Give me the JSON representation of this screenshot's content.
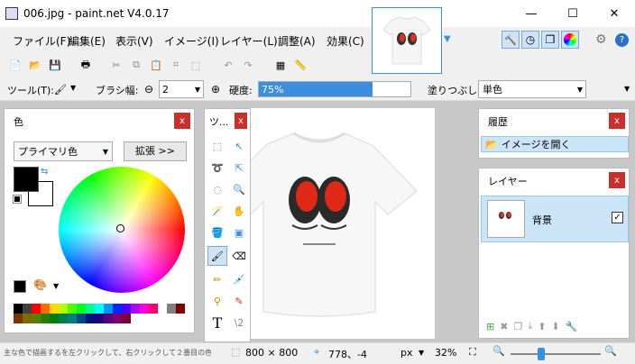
{
  "titlebar": {
    "title": "006.jpg - paint.net V4.0.17",
    "min": "—",
    "max": "☐",
    "close": "✕"
  },
  "menu": [
    "ファイル(F)",
    "編集(E)",
    "表示(V)",
    "イメージ(I)",
    "レイヤー(L)",
    "調整(A)",
    "効果(C)"
  ],
  "toolbar2": {
    "tool_label": "ツール(T):",
    "brush_label": "ブラシ幅:",
    "brush_value": "2",
    "hardness_label": "硬度:",
    "hardness_value": "75%",
    "hardness_percent": 75,
    "fill_label": "塗りつぶし:",
    "fill_value": "単色"
  },
  "colors": {
    "title": "色",
    "mode": "プライマリ色",
    "expand": "拡張 >>",
    "primary": "#000000",
    "secondary": "#ffffff"
  },
  "tools": {
    "title": "ツ..."
  },
  "history": {
    "title": "履歴",
    "item": "イメージを開く"
  },
  "layers": {
    "title": "レイヤー",
    "item": "背景"
  },
  "status": {
    "hint": "主な色で描画するを左クリックして、右クリックして２番目の色と描画",
    "size": "800 × 800",
    "cursor": "778、-4",
    "unit": "px",
    "zoom": "32%"
  },
  "palette": [
    "#000000",
    "#404040",
    "#ff0000",
    "#ff6a00",
    "#ffd800",
    "#b6ff00",
    "#4cff00",
    "#00ff21",
    "#00ff90",
    "#00ffff",
    "#0094ff",
    "#0026ff",
    "#4800ff",
    "#b200ff",
    "#ff00dc",
    "#ff006e",
    "#ffffff",
    "#808080",
    "#7f0000",
    "#7f3300",
    "#7f6a00",
    "#5b7f00",
    "#267f00",
    "#007f0e",
    "#007f46",
    "#007f7f",
    "#004a7f",
    "#00137f",
    "#21007f",
    "#57007f",
    "#7f006e",
    "#7f0037"
  ]
}
